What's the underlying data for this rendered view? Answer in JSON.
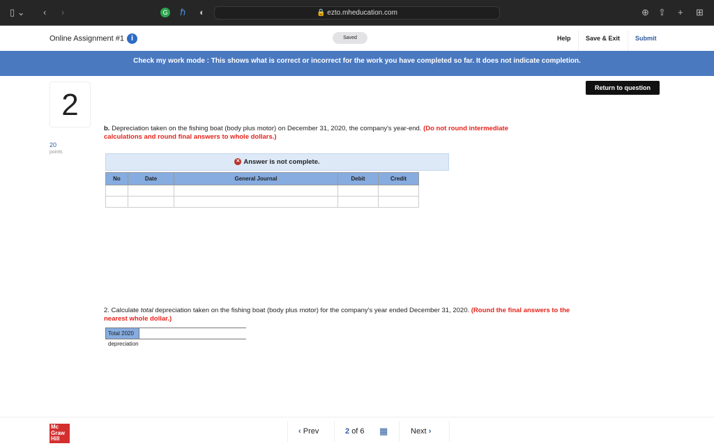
{
  "browser": {
    "url": "ezto.mheducation.com",
    "badge": "1"
  },
  "header": {
    "title": "Online Assignment #1",
    "saved": "Saved",
    "help": "Help",
    "save_exit": "Save & Exit",
    "submit": "Submit"
  },
  "banner": "Check my work mode : This shows what is correct or incorrect for the work you have completed so far. It does not indicate completion.",
  "return_button": "Return to question",
  "question": {
    "number": "2",
    "points": "20",
    "points_label": "points",
    "part_b_prefix": "b.",
    "part_b": " Depreciation taken on the fishing boat (body plus motor) on December 31, 2020, the company's year-end. ",
    "part_b_red": "(Do not round intermediate calculations and round final answers to whole dollars.)",
    "status": "Answer is not complete.",
    "columns": [
      "No",
      "Date",
      "General Journal",
      "Debit",
      "Credit"
    ],
    "part2_prefix": "2. Calculate ",
    "part2_em": "total",
    "part2": " depreciation taken on the fishing boat (body plus motor) for the company's year ended December 31, 2020. ",
    "part2_red": "(Round the final answers to the nearest whole dollar.)",
    "total_label": "Total 2020 depreciation",
    "total_value": ""
  },
  "footer": {
    "logo": "Mc Graw Hill",
    "prev": "Prev",
    "current": "2",
    "of": "of 6",
    "next": "Next"
  }
}
